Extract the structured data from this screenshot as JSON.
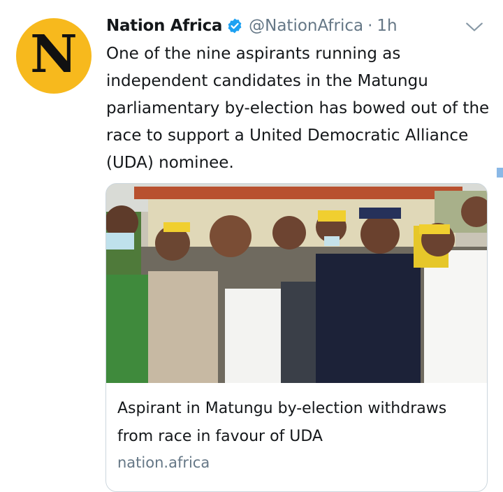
{
  "author": {
    "avatar_letter": "N",
    "avatar_color": "#f7b91d",
    "display_name": "Nation Africa",
    "handle": "@NationAfrica",
    "separator": "·",
    "time": "1h",
    "verified_icon": "verified-badge-icon",
    "verified_color": "#1da1f2"
  },
  "tweet": {
    "text": "One of the nine aspirants running as independent candidates in the Matungu parliamentary by-election has bowed out of the race to support a United Democratic Alliance (UDA) nominee."
  },
  "card": {
    "title": "Aspirant in Matungu by-election withdraws from race in favour of UDA",
    "domain": "nation.africa"
  },
  "menu": {
    "icon": "chevron-down-icon"
  }
}
